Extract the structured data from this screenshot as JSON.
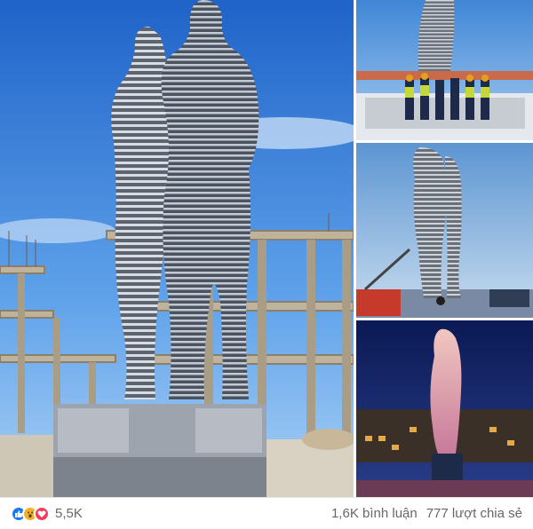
{
  "photos": [
    {
      "id": "main",
      "alt": "statue-day"
    },
    {
      "id": "crew"
    },
    {
      "id": "crane"
    },
    {
      "id": "night"
    }
  ],
  "reactions": {
    "icons": [
      "like-icon",
      "wow-icon",
      "love-icon"
    ],
    "count": "5,5K"
  },
  "stats": {
    "comments": "1,6K bình luận",
    "shares": "777 lượt chia sẻ"
  },
  "colors": {
    "like": "#1877f2",
    "wow": "#f7b125",
    "love": "#f33e58",
    "meta_text": "#65676b"
  }
}
